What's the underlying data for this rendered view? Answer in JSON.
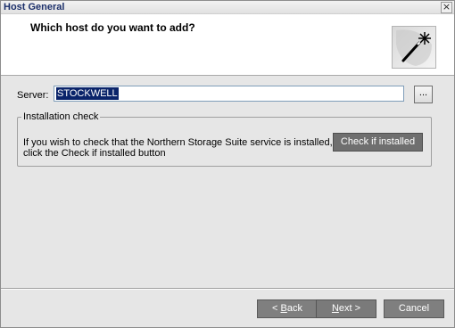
{
  "window": {
    "title": "Host General",
    "close_glyph": "×"
  },
  "header": {
    "question": "Which host do you want to add?",
    "icon": "magic-wand-icon"
  },
  "server": {
    "label": "Server:",
    "value": "STOCKWELL",
    "browse_label": "..."
  },
  "installation_check": {
    "legend": "Installation check",
    "description": "If you wish to check that the Northern Storage Suite service is installed, click the Check if installed button",
    "check_button": "Check if installed"
  },
  "footer": {
    "back": {
      "prefix": "< ",
      "mnemonic": "B",
      "rest": "ack"
    },
    "next": {
      "mnemonic": "N",
      "rest": "ext >"
    },
    "cancel": "Cancel"
  }
}
